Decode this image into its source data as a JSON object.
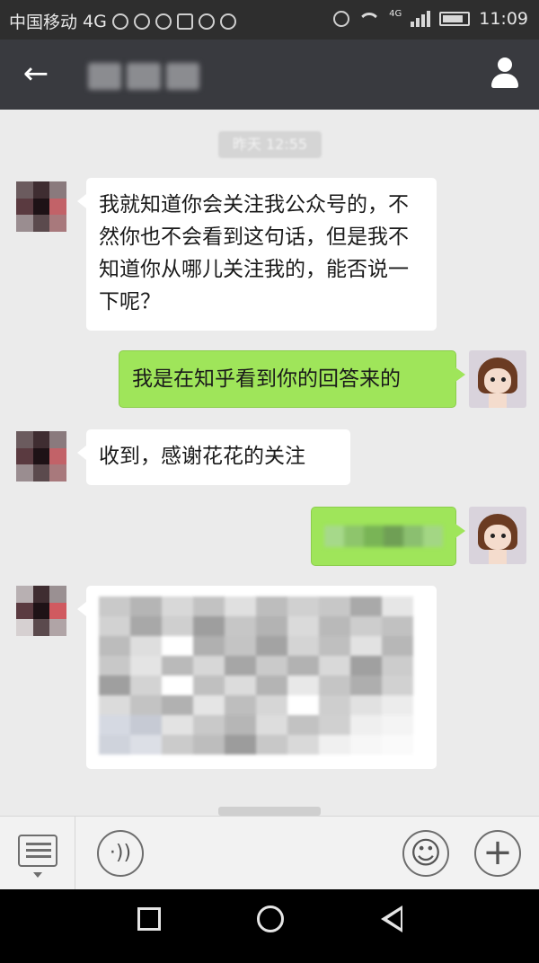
{
  "status_bar": {
    "carrier": "中国移动",
    "network": "4G",
    "network_small": "4G",
    "time": "11:09",
    "icons": [
      "shield-icon",
      "weibo-icon",
      "weibo-icon",
      "image-icon",
      "vpn-icon",
      "account-icon",
      "alarm-icon",
      "wifi-icon",
      "signal-icon",
      "battery-icon"
    ]
  },
  "header": {
    "back_icon": "←",
    "title_blurred": true,
    "profile_icon": "person-icon"
  },
  "chat": {
    "timestamp": "昨天 12:55",
    "messages": [
      {
        "side": "left",
        "text": "我就知道你会关注我公众号的，不然你也不会看到这句话，但是我不知道你从哪儿关注我的，能否说一下呢？",
        "avatar": "pixelated-avatar"
      },
      {
        "side": "right",
        "text": "我是在知乎看到你的回答来的",
        "avatar": "cartoon-girl-avatar"
      },
      {
        "side": "left",
        "text": "收到，感谢花花的关注",
        "avatar": "pixelated-avatar"
      },
      {
        "side": "right",
        "text": "",
        "blurred": true,
        "avatar": "cartoon-girl-avatar"
      },
      {
        "side": "left",
        "text": "",
        "blurred": true,
        "avatar": "pixelated-avatar"
      }
    ]
  },
  "input_bar": {
    "menu_icon": "menu-list-icon",
    "voice_icon": "voice-icon",
    "voice_glyph": "·))",
    "emoji_icon": "emoji-icon",
    "emoji_glyph": "☺",
    "plus_icon": "plus-icon",
    "plus_glyph": "+"
  },
  "nav_bar": {
    "items": [
      "recent-apps-icon",
      "home-icon",
      "back-triangle-icon"
    ]
  },
  "colors": {
    "title_bar": "#393a3f",
    "status_bar": "#2e2e2e",
    "chat_bg": "#ebebeb",
    "bubble_right": "#9fe55a",
    "bubble_left": "#ffffff"
  }
}
